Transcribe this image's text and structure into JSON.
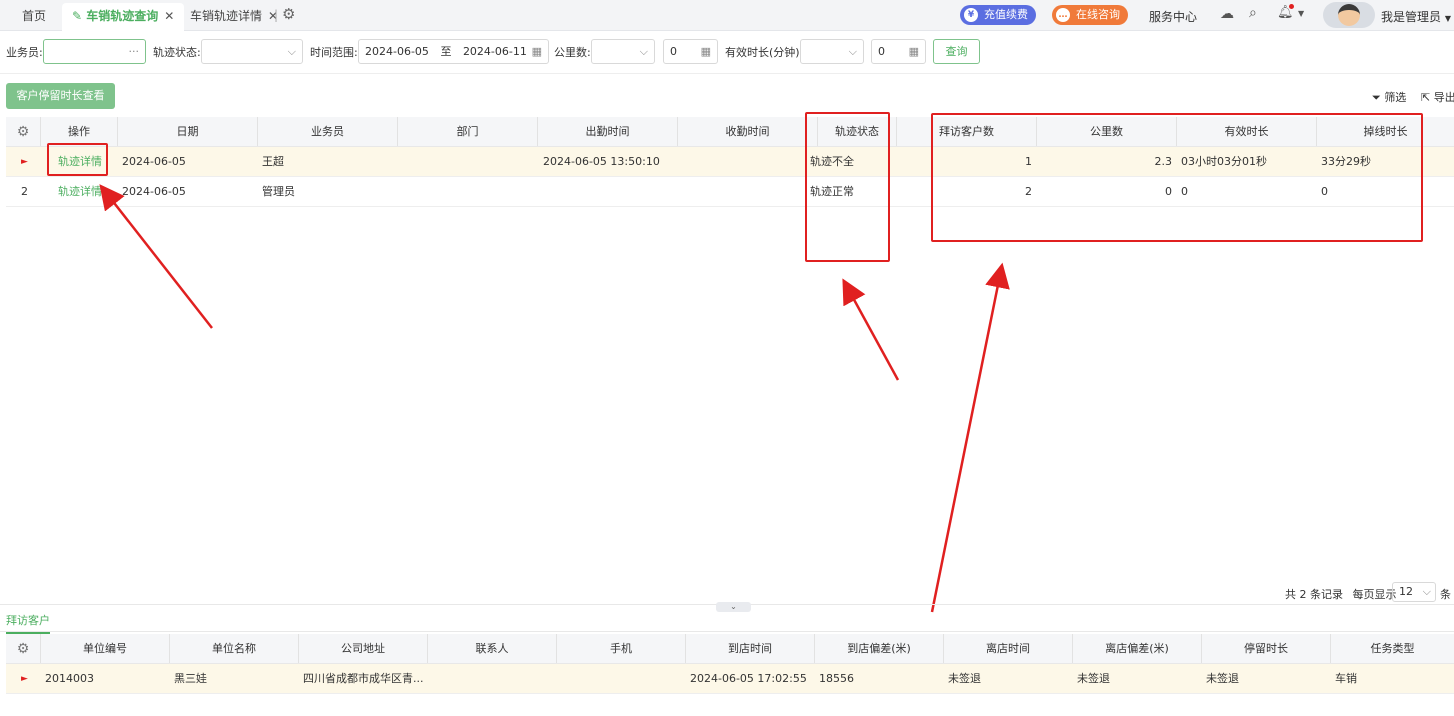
{
  "tabs": [
    {
      "label": "首页"
    },
    {
      "label": "车销轨迹查询",
      "close": "✕"
    },
    {
      "label": "车销轨迹详情",
      "close": "✕"
    }
  ],
  "header": {
    "recharge": "充值续费",
    "consult": "在线咨询",
    "service": "服务中心",
    "user": "我是管理员"
  },
  "filters": {
    "salesman_label": "业务员:",
    "salesman_more": "···",
    "status_label": "轨迹状态:",
    "range_label": "时间范围:",
    "date_from": "2024-06-05",
    "date_sep": "至",
    "date_to": "2024-06-11",
    "km_label": "公里数:",
    "km_value": "0",
    "duration_label": "有效时长(分钟):",
    "duration_value": "0",
    "query_btn": "查询"
  },
  "toolbar": {
    "stay_btn": "客户停留时长查看",
    "filter": "筛选",
    "export": "导出"
  },
  "main_table": {
    "headers": [
      "操作",
      "日期",
      "业务员",
      "部门",
      "出勤时间",
      "收勤时间",
      "轨迹状态",
      "拜访客户数",
      "公里数",
      "有效时长",
      "掉线时长"
    ],
    "rows": [
      {
        "index": "►",
        "op": "轨迹详情",
        "date": "2024-06-05",
        "salesman": "王超",
        "dept": "",
        "checkin": "2024-06-05 13:50:10",
        "checkout": "",
        "status": "轨迹不全",
        "visits": "1",
        "km": "2.3",
        "effective": "03小时03分01秒",
        "offline": "33分29秒"
      },
      {
        "index": "2",
        "op": "轨迹详情",
        "date": "2024-06-05",
        "salesman": "管理员",
        "dept": "",
        "checkin": "",
        "checkout": "",
        "status": "轨迹正常",
        "visits": "2",
        "km": "0",
        "effective": "0",
        "offline": "0"
      }
    ]
  },
  "pagination": {
    "total": "共 2 条记录",
    "per_page_label": "每页显示",
    "per_page": "12",
    "unit": "条"
  },
  "bottom": {
    "tab": "拜访客户",
    "headers": [
      "单位编号",
      "单位名称",
      "公司地址",
      "联系人",
      "手机",
      "到店时间",
      "到店偏差(米)",
      "离店时间",
      "离店偏差(米)",
      "停留时长",
      "任务类型"
    ],
    "rows": [
      {
        "index": "►",
        "code": "2014003",
        "name": "黑三娃",
        "address": "四川省成都市成华区青...",
        "contact": "",
        "phone": "",
        "arrive": "2024-06-05 17:02:55",
        "arrive_dev": "18556",
        "leave": "未签退",
        "leave_dev": "未签退",
        "stay": "未签退",
        "task": "车销"
      }
    ]
  },
  "colors": {
    "accent": "#4bae5f",
    "annotation": "#e02020",
    "recharge": "#5b6ee1",
    "consult": "#f07a3a"
  }
}
